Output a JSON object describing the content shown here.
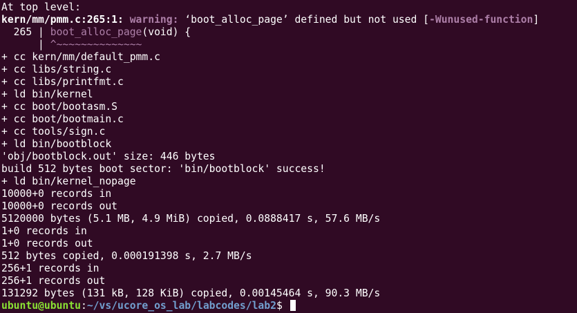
{
  "warning": {
    "header": "At top level:",
    "location": "kern/mm/pmm.c:265:1:",
    "label": "warning:",
    "message": "‘boot_alloc_page’ defined but not used [",
    "flag": "-Wunused-function",
    "close": "]",
    "code_prefix": "  265 | ",
    "code_fn": "boot_alloc_page",
    "code_rest": "(void) {",
    "caret_prefix": "      | ",
    "caret": "^~~~~~~~~~~~~~~"
  },
  "output_lines": [
    "+ cc kern/mm/default_pmm.c",
    "+ cc libs/string.c",
    "+ cc libs/printfmt.c",
    "+ ld bin/kernel",
    "+ cc boot/bootasm.S",
    "+ cc boot/bootmain.c",
    "+ cc tools/sign.c",
    "+ ld bin/bootblock",
    "'obj/bootblock.out' size: 446 bytes",
    "build 512 bytes boot sector: 'bin/bootblock' success!",
    "+ ld bin/kernel_nopage",
    "10000+0 records in",
    "10000+0 records out",
    "5120000 bytes (5.1 MB, 4.9 MiB) copied, 0.0888417 s, 57.6 MB/s",
    "1+0 records in",
    "1+0 records out",
    "512 bytes copied, 0.000191398 s, 2.7 MB/s",
    "256+1 records in",
    "256+1 records out",
    "131292 bytes (131 kB, 128 KiB) copied, 0.00145464 s, 90.3 MB/s"
  ],
  "prompt": {
    "user_host": "ubuntu@ubuntu",
    "colon": ":",
    "path": "~/vs/ucore_os_lab/labcodes/lab2",
    "symbol": "$ "
  },
  "colors": {
    "background": "#300a24",
    "text": "#ffffff",
    "warning": "#ad7fa8",
    "prompt_user": "#8ae234",
    "prompt_path": "#729fcf"
  }
}
